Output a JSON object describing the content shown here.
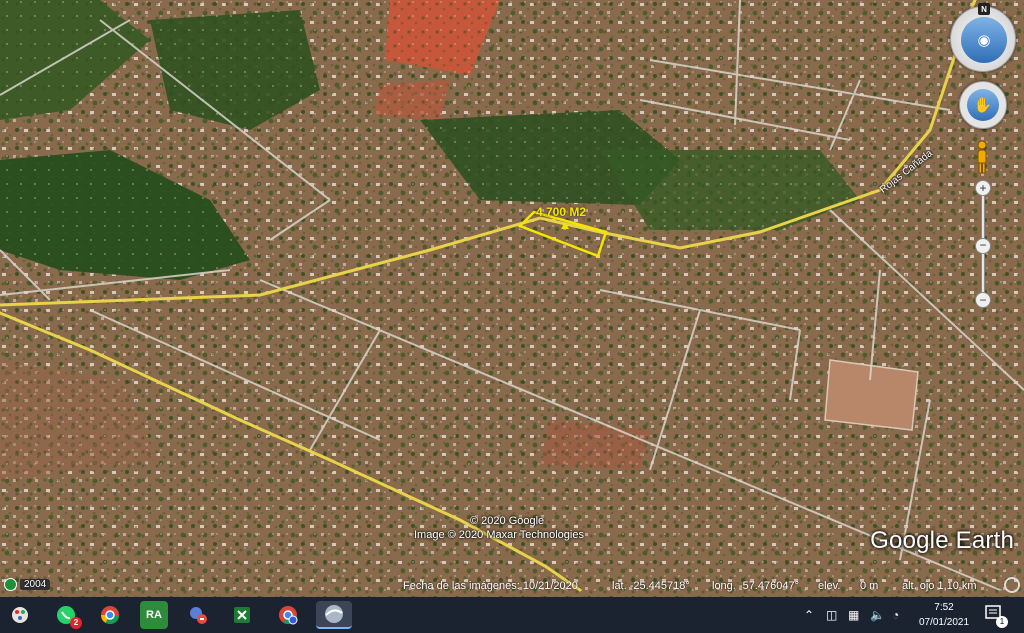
{
  "map": {
    "road_label": "Rojas Cañada",
    "area_label": "4.700 M2",
    "copyright_line1": "© 2020 Google",
    "copyright_line2": "Image © 2020 Maxar Technologies",
    "logo": "Google Earth",
    "north_label": "N"
  },
  "status_bar": {
    "year": "2004",
    "imagery_date": "Fecha de las imágenes: 10/21/2020",
    "lat": "lat.  -25.445718°",
    "long": "long.  -57.476047°",
    "elev_label": "elev.",
    "elev_value": "0 m",
    "eye_alt": "alt. ojo   1,10 km"
  },
  "taskbar": {
    "whatsapp_badge": "2",
    "ra_label": "RA",
    "time": "7:52",
    "date": "07/01/2021",
    "notifications": "1"
  },
  "colors": {
    "road_yellow": "#e8d24a",
    "polygon_yellow": "#f5e600",
    "taskbar_bg": "#1b2330"
  }
}
